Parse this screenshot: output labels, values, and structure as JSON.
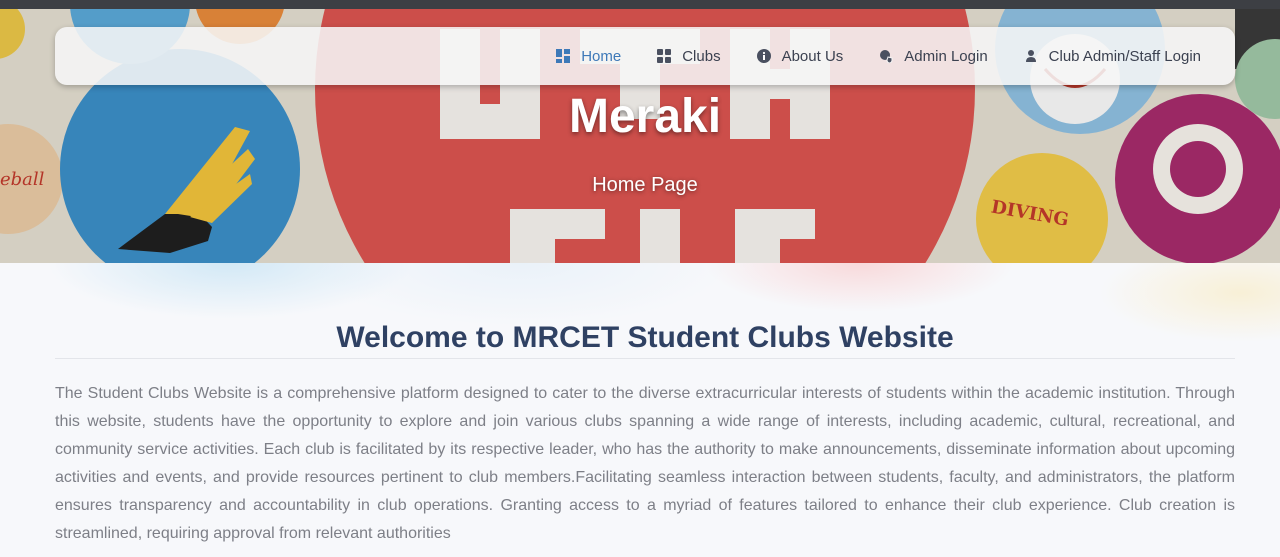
{
  "nav": {
    "items": [
      {
        "label": "Home",
        "icon": "dashboard-icon",
        "active": true
      },
      {
        "label": "Clubs",
        "icon": "grid-icon",
        "active": false
      },
      {
        "label": "About Us",
        "icon": "info-icon",
        "active": false
      },
      {
        "label": "Admin Login",
        "icon": "user-shield-icon",
        "active": false
      },
      {
        "label": "Club Admin/Staff Login",
        "icon": "user-icon",
        "active": false
      }
    ],
    "active_color": "#3e79b8"
  },
  "hero": {
    "title": "Meraki",
    "subtitle": "Home Page"
  },
  "main": {
    "heading": "Welcome to MRCET Student Clubs Website",
    "description": "The Student Clubs Website is a comprehensive platform designed to cater to the diverse extracurricular interests of students within the academic institution. Through this website, students have the opportunity to explore and join various clubs spanning a wide range of interests, including academic, cultural, recreational, and community service activities. Each club is facilitated by its respective leader, who has the authority to make announcements, disseminate information about upcoming activities and events, and provide resources pertinent to club members.Facilitating seamless interaction between students, faculty, and administrators, the platform ensures transparency and accountability in club operations. Granting access to a myriad of features tailored to enhance their club experience. Club creation is streamlined, requiring approval from relevant authorities"
  },
  "colors": {
    "heading": "#2f4163",
    "body_text": "#7d7f87"
  }
}
